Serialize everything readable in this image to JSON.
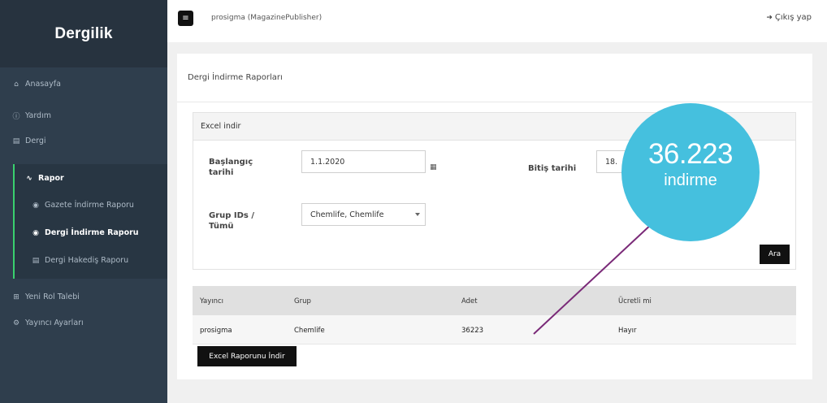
{
  "sidebar": {
    "brand": "Dergilik",
    "items": [
      {
        "label": "Anasayfa",
        "icon": "home-icon"
      },
      {
        "label": "Yardım",
        "icon": "help-icon"
      },
      {
        "label": "Dergi",
        "icon": "book-icon"
      },
      {
        "label": "Rapor",
        "icon": "chart-icon"
      },
      {
        "label": "Gazete İndirme Raporu",
        "icon": "radio-icon"
      },
      {
        "label": "Dergi İndirme Raporu",
        "icon": "radio-icon"
      },
      {
        "label": "Dergi Hakediş Raporu",
        "icon": "money-icon"
      },
      {
        "label": "Yeni Rol Talebi",
        "icon": "plus-square-icon"
      },
      {
        "label": "Yayıncı Ayarları",
        "icon": "gear-icon"
      }
    ]
  },
  "topbar": {
    "user": "prosigma (MagazinePublisher)",
    "logout_label": "Çıkış yap"
  },
  "panel": {
    "title": "Dergi İndirme Raporları",
    "filter": {
      "header": "Excel indir",
      "start_label_1": "Başlangıç",
      "start_label_2": "tarihi",
      "start_value": "1.1.2020",
      "end_label": "Bitiş tarihi",
      "end_value": "18.",
      "group_label_1": "Grup IDs /",
      "group_label_2": "Tümü",
      "group_value": "Chemlife, Chemlife",
      "search_label": "Ara"
    },
    "table": {
      "columns": [
        "Yayıncı",
        "Grup",
        "Adet",
        "Ücretli mi"
      ],
      "rows": [
        [
          "prosigma",
          "Chemlife",
          "36223",
          "Hayır"
        ]
      ]
    },
    "excel_button": "Excel Raporunu İndir"
  },
  "callout": {
    "number": "36.223",
    "text": "indirme",
    "color": "#45c0de",
    "line_color": "#7a2a78"
  }
}
